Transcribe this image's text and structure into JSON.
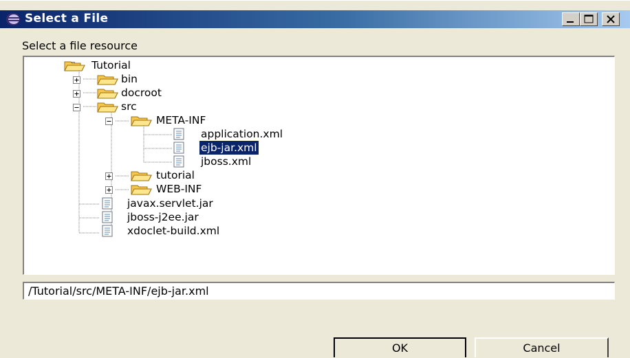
{
  "window": {
    "title": "Select a File"
  },
  "title_buttons": {
    "minimize": "minimize-icon",
    "maximize": "maximize-icon",
    "close": "close-icon"
  },
  "prompt": "Select a file resource",
  "tree": {
    "items": [
      {
        "label": "Tutorial",
        "type": "folder",
        "expanded": true
      },
      {
        "label": "bin",
        "type": "folder",
        "expanded": false
      },
      {
        "label": "docroot",
        "type": "folder",
        "expanded": false
      },
      {
        "label": "src",
        "type": "folder",
        "expanded": true
      },
      {
        "label": "META-INF",
        "type": "folder",
        "expanded": true
      },
      {
        "label": "application.xml",
        "type": "file"
      },
      {
        "label": "ejb-jar.xml",
        "type": "file",
        "selected": true
      },
      {
        "label": "jboss.xml",
        "type": "file"
      },
      {
        "label": "tutorial",
        "type": "folder",
        "expanded": false
      },
      {
        "label": "WEB-INF",
        "type": "folder",
        "expanded": false
      },
      {
        "label": "javax.servlet.jar",
        "type": "file"
      },
      {
        "label": "jboss-j2ee.jar",
        "type": "file"
      },
      {
        "label": "xdoclet-build.xml",
        "type": "file"
      }
    ]
  },
  "path_field": {
    "value": "/Tutorial/src/META-INF/ejb-jar.xml"
  },
  "buttons": {
    "ok": "OK",
    "cancel": "Cancel"
  },
  "colors": {
    "selection": "#0a246a",
    "titlebar_start": "#0a246a",
    "titlebar_end": "#a6caf0",
    "face": "#ece9d8"
  }
}
